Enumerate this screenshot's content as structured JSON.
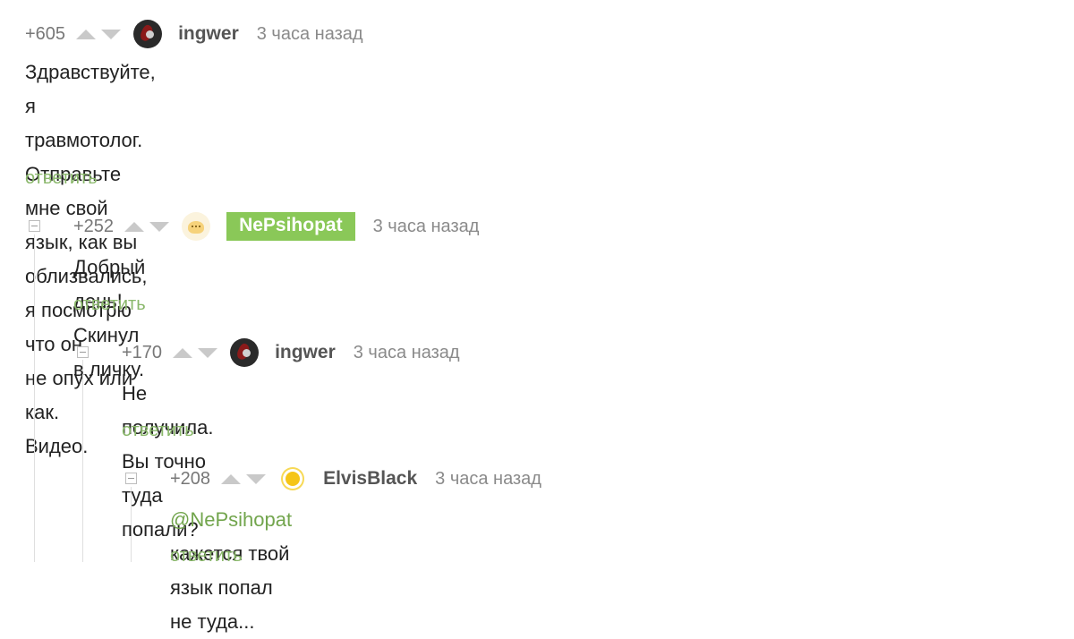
{
  "comments": [
    {
      "rating": "+605",
      "username": "ingwer",
      "avatar_icon": "user-avatar-dark-icon",
      "timestamp": "3 часа назад",
      "lines": [
        "Здравствуйте, я травмотолог. Отправьте мне свой язык, как вы облизвались, я посмотрю что он",
        "не опух или как.",
        "Видео."
      ],
      "reply_label": "ответить"
    },
    {
      "rating": "+252",
      "username": "NePsihopat",
      "username_badge": true,
      "avatar_icon": "user-avatar-egg-icon",
      "timestamp": "3 часа назад",
      "lines": [
        "Добрый день! Скинул в личку."
      ],
      "reply_label": "ответить"
    },
    {
      "rating": "+170",
      "username": "ingwer",
      "avatar_icon": "user-avatar-dark-icon",
      "timestamp": "3 часа назад",
      "lines": [
        "Не получила. Вы точно туда попали?"
      ],
      "reply_label": "ответить"
    },
    {
      "rating": "+208",
      "username": "ElvisBlack",
      "avatar_icon": "user-avatar-sun-icon",
      "timestamp": "3 часа назад",
      "mention": "@NePsihopat",
      "text_after_mention": " кажется твой язык попал не туда...",
      "reply_label": "ответить"
    }
  ],
  "colors": {
    "accent_green": "#8ac858",
    "reply_green": "#8ab86b",
    "muted_gray": "#8a8a8a"
  }
}
